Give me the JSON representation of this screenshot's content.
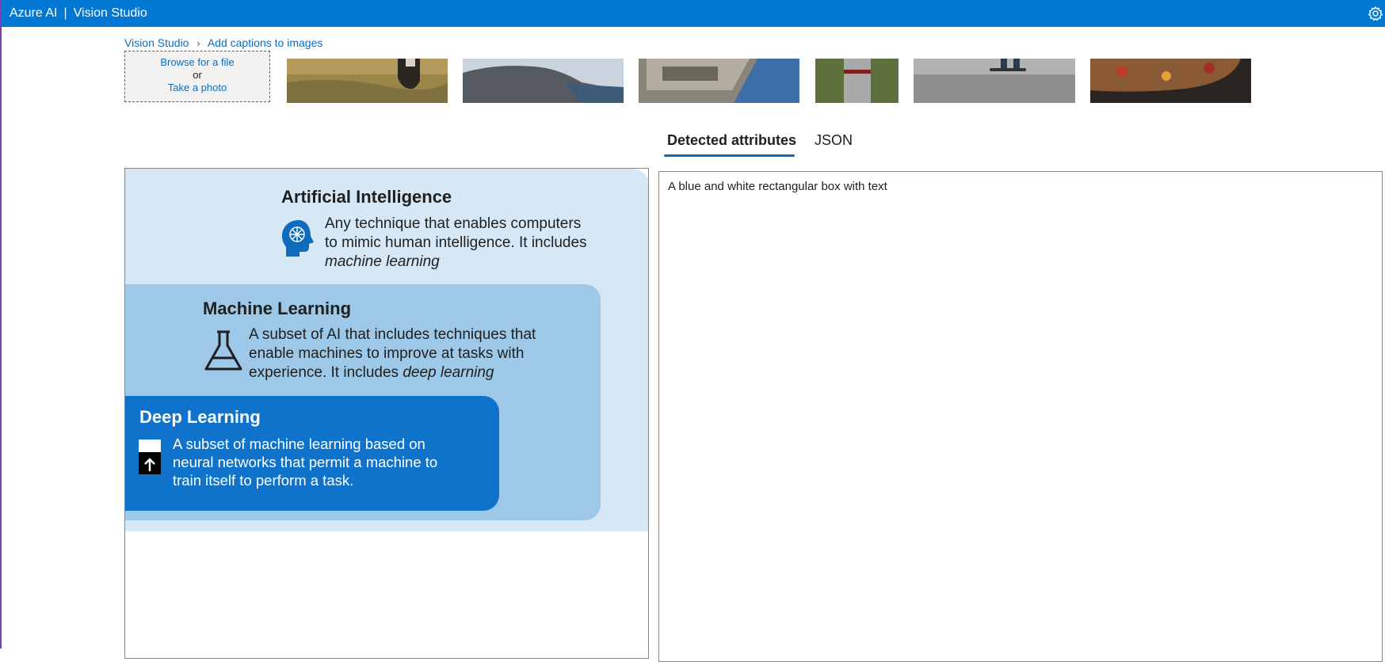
{
  "app": {
    "brand_left": "Azure AI",
    "separator": "|",
    "brand_right": "Vision Studio",
    "settings_icon": "gear-icon"
  },
  "breadcrumb": {
    "root": "Vision Studio",
    "current": "Add captions to images"
  },
  "upload": {
    "browse": "Browse for a file",
    "or": "or",
    "photo": "Take a photo"
  },
  "tabs": [
    {
      "label": "Detected attributes",
      "active": true
    },
    {
      "label": "JSON",
      "active": false
    }
  ],
  "infographic": {
    "ai": {
      "title": "Artificial Intelligence",
      "line1": "Any technique that enables computers",
      "line2": "to mimic human intelligence. It includes",
      "line3": "machine learning"
    },
    "ml": {
      "title": "Machine Learning",
      "line1": "A subset of AI that includes techniques that",
      "line2": "enable machines to improve at tasks with",
      "line3a": "experience. It includes ",
      "line3b": "deep learning"
    },
    "dl": {
      "title": "Deep Learning",
      "line1": "A subset of machine learning based on",
      "line2": "neural networks that permit a machine to",
      "line3": "train itself to perform a task."
    }
  },
  "results": {
    "caption": "A blue and white rectangular box with text"
  },
  "colors": {
    "topbar": "#0078d4",
    "link": "#0f6cbd",
    "ai_bg": "#d6e8f5",
    "ml_bg": "#9dc8e8",
    "dl_bg": "#0f73cc"
  }
}
